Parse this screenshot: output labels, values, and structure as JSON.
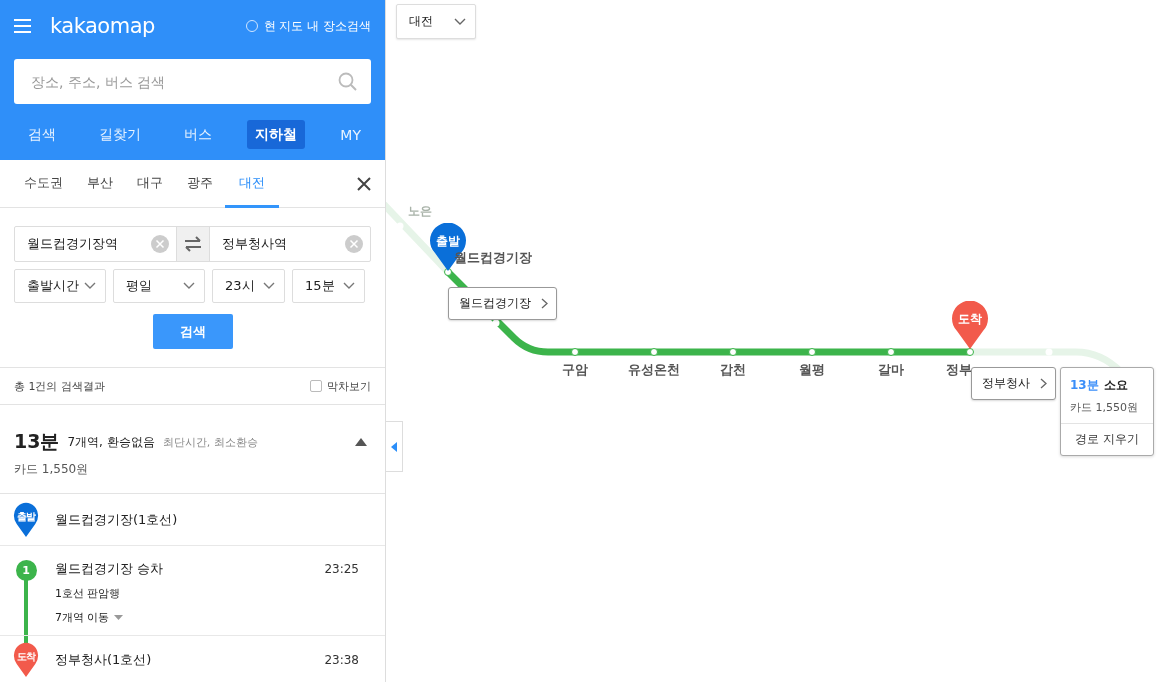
{
  "header": {
    "logo": "kakaomap",
    "area_search": {
      "label": "현 지도 내 장소검색",
      "checked": false
    }
  },
  "search": {
    "placeholder": "장소, 주소, 버스 검색"
  },
  "nav_tabs": [
    {
      "label": "검색",
      "selected": false
    },
    {
      "label": "길찾기",
      "selected": false
    },
    {
      "label": "버스",
      "selected": false
    },
    {
      "label": "지하철",
      "selected": true
    },
    {
      "label": "MY",
      "selected": false
    }
  ],
  "region_tabs": [
    {
      "label": "수도권",
      "selected": false
    },
    {
      "label": "부산",
      "selected": false
    },
    {
      "label": "대구",
      "selected": false
    },
    {
      "label": "광주",
      "selected": false
    },
    {
      "label": "대전",
      "selected": true
    }
  ],
  "route_form": {
    "origin": "월드컵경기장역",
    "destination": "정부청사역",
    "selects": [
      "출발시간",
      "평일",
      "23시",
      "15분"
    ],
    "search_button": "검색"
  },
  "results": {
    "count_text": "총 1건의 검색결과",
    "last_train": {
      "label": "막차보기",
      "checked": false
    }
  },
  "route": {
    "duration": "13분",
    "summary": "7개역, 환승없음",
    "tags": "최단시간, 최소환승",
    "fare": "카드 1,550원",
    "expanded": true,
    "steps": [
      {
        "kind": "departure",
        "pin": "출발",
        "title": "월드컵경기장(1호선)"
      },
      {
        "kind": "board",
        "badge": "1",
        "title": "월드컵경기장 승차",
        "time": "23:25",
        "detail": "1호선 판암행",
        "stops": "7개역 이동"
      },
      {
        "kind": "arrival",
        "pin": "도착",
        "title": "정부청사(1호선)",
        "time": "23:38"
      }
    ]
  },
  "map": {
    "region_select": "대전",
    "faint_label": "노은",
    "stations": [
      "구암",
      "유성온천",
      "갑천",
      "월평",
      "갈마",
      "정부"
    ],
    "start_pin": "출발",
    "start_label": "월드컵경기장",
    "start_callout": "월드컵경기장",
    "end_pin": "도착",
    "end_callout": "정부청사",
    "info": {
      "duration": "13분",
      "suffix": "소요",
      "fare": "카드 1,550원",
      "clear_button": "경로 지우기"
    }
  }
}
